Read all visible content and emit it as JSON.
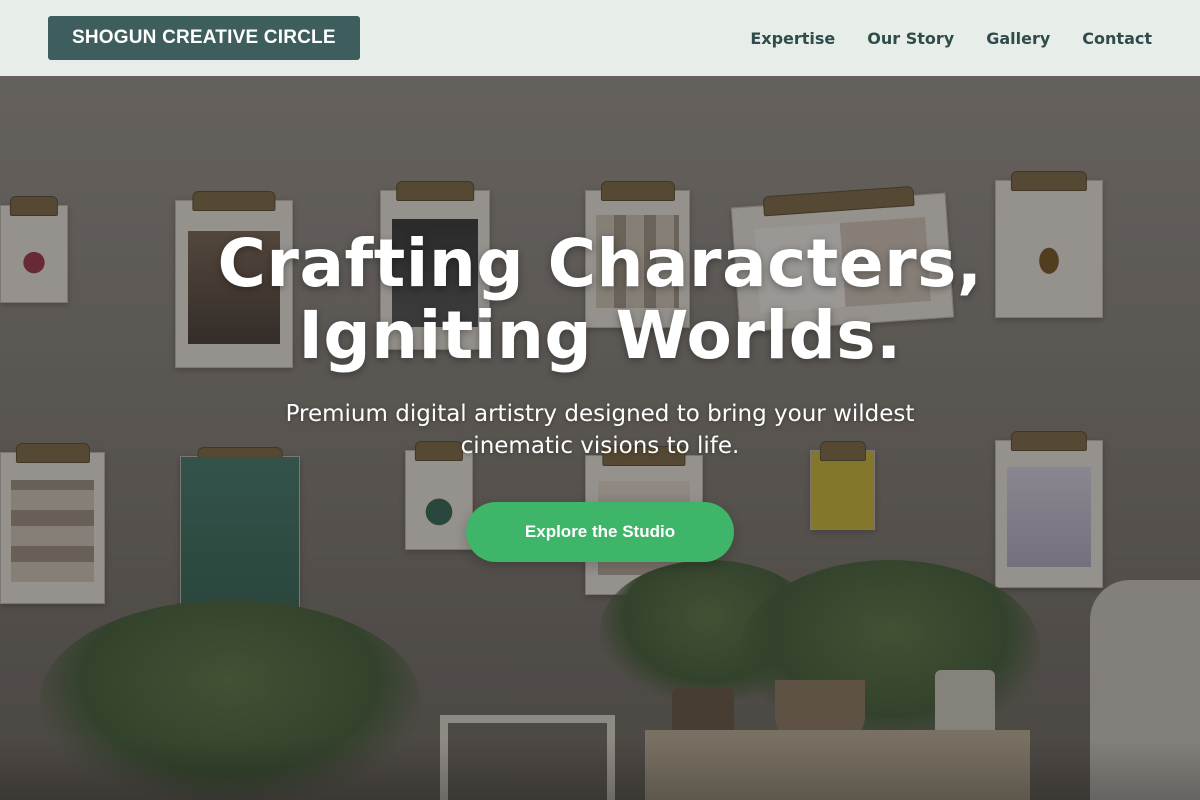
{
  "nav": {
    "brand": "SHOGUN CREATIVE CIRCLE",
    "links": [
      "Expertise",
      "Our Story",
      "Gallery",
      "Contact"
    ]
  },
  "hero": {
    "title_line1": "Crafting Characters,",
    "title_line2": "Igniting Worlds.",
    "subtitle": "Premium digital artistry designed to bring your wildest cinematic visions to life.",
    "cta_label": "Explore the Studio"
  },
  "colors": {
    "brand_bg": "#3d5e5c",
    "nav_bg": "#ecf2ee",
    "nav_text": "#2f4b4a",
    "cta": "#3fb56a"
  }
}
